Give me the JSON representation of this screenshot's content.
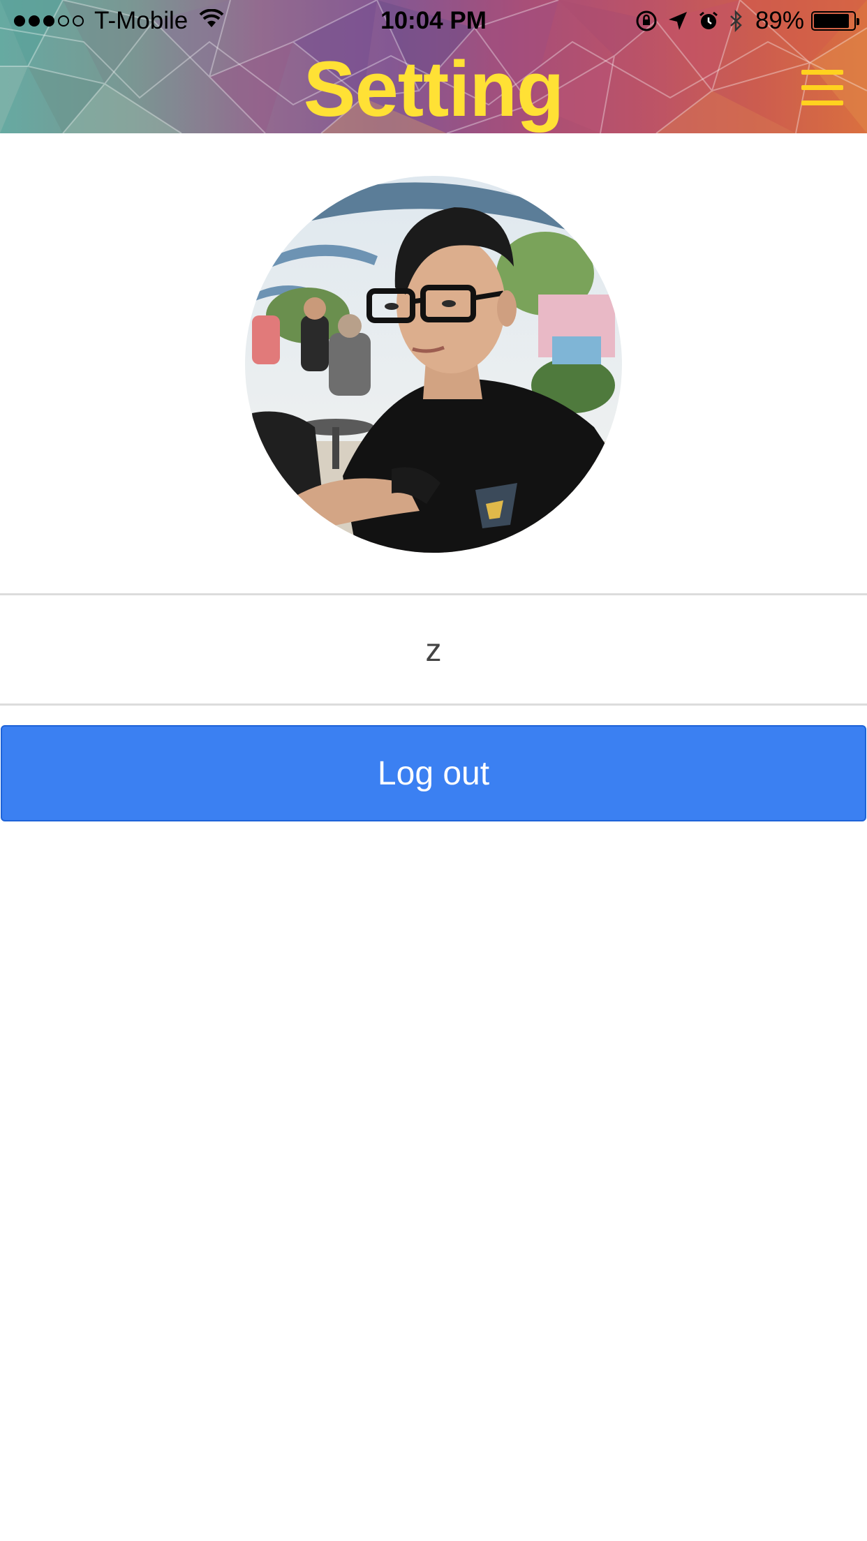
{
  "status_bar": {
    "signal_filled": 3,
    "signal_total": 5,
    "carrier": "T-Mobile",
    "time": "10:04 PM",
    "battery_percent": "89%",
    "battery_level": 0.89,
    "icons": [
      "wifi-icon",
      "orientation-lock-icon",
      "location-arrow-icon",
      "alarm-icon",
      "bluetooth-icon",
      "battery-icon"
    ]
  },
  "header": {
    "title": "Setting",
    "menu_icon": "hamburger-menu-icon"
  },
  "profile": {
    "avatar": "profile-photo",
    "username": "z"
  },
  "actions": {
    "logout_label": "Log out"
  },
  "colors": {
    "title": "#ffe135",
    "menu_icon": "#ffd21f",
    "button_bg": "#3b80f2",
    "button_border": "#1e63d8",
    "divider": "#dcdcdc",
    "username_text": "#444444"
  }
}
